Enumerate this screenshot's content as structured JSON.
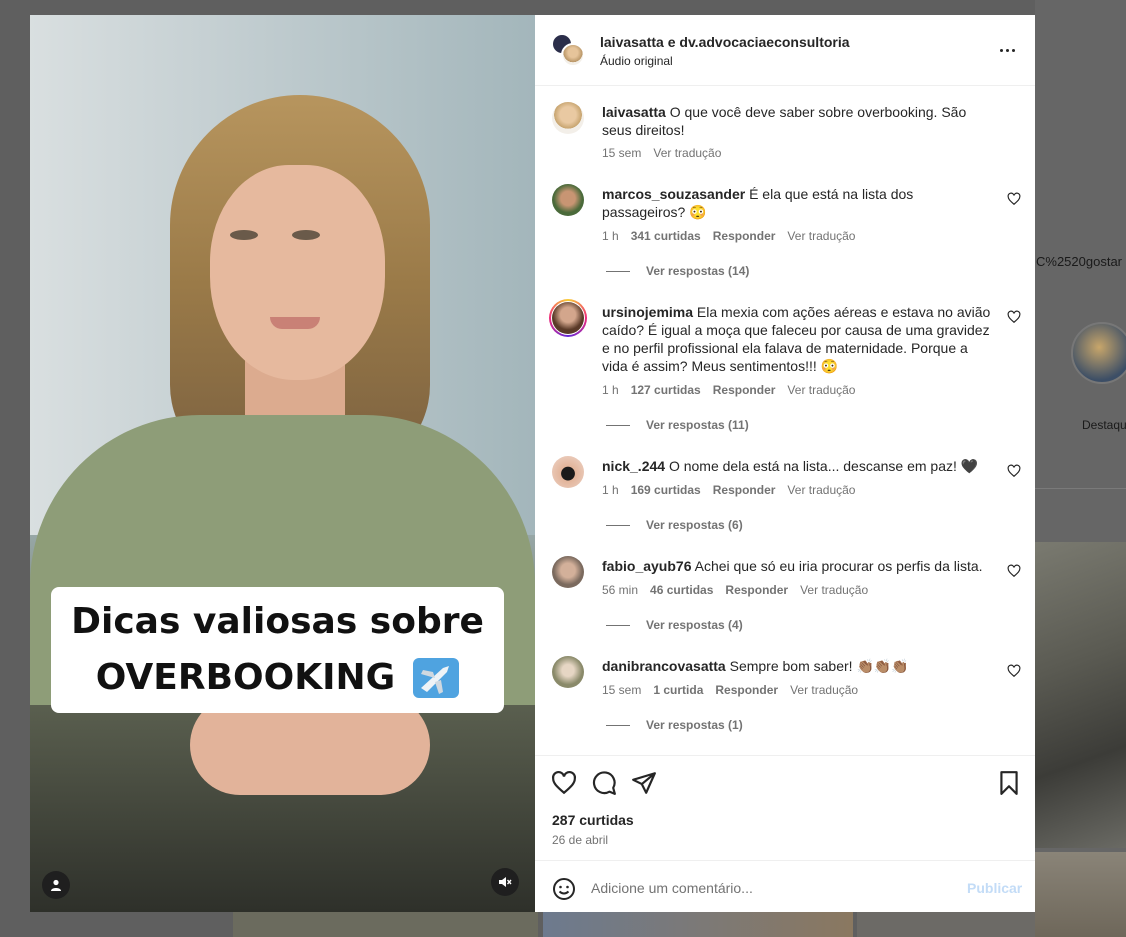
{
  "background": {
    "partial_text": "C%2520gostar",
    "highlight_label": "Destaqu"
  },
  "video": {
    "caption_line1": "Dicas valiosas sobre",
    "caption_line2": "OVERBOOKING",
    "caption_emoji": "airplane-icon"
  },
  "header": {
    "authors": "laivasatta e dv.advocaciaeconsultoria",
    "audio": "Áudio original",
    "more_icon": "more-options-icon"
  },
  "caption": {
    "user": "laivasatta",
    "text": "O que você deve saber sobre overbooking. São seus direitos!",
    "time": "15 sem",
    "translate": "Ver tradução"
  },
  "comments": [
    {
      "user": "marcos_souzasander",
      "text": "É ela que está na lista dos passageiros? 😳",
      "time": "1 h",
      "likes": "341 curtidas",
      "reply": "Responder",
      "translate": "Ver tradução",
      "replies": "Ver respostas (14)"
    },
    {
      "user": "ursinojemima",
      "text": "Ela mexia com ações aéreas e estava no avião caído? É igual a moça que faleceu por causa de uma gravidez e no perfil profissional ela falava de maternidade. Porque a vida é assim? Meus sentimentos!!! 😳",
      "time": "1 h",
      "likes": "127 curtidas",
      "reply": "Responder",
      "translate": "Ver tradução",
      "replies": "Ver respostas (11)"
    },
    {
      "user": "nick_.244",
      "text": "O nome dela está na lista... descanse em paz! 🖤",
      "time": "1 h",
      "likes": "169 curtidas",
      "reply": "Responder",
      "translate": "Ver tradução",
      "replies": "Ver respostas (6)"
    },
    {
      "user": "fabio_ayub76",
      "text": "Achei que só eu iria procurar os perfis da lista.",
      "time": "56 min",
      "likes": "46 curtidas",
      "reply": "Responder",
      "translate": "Ver tradução",
      "replies": "Ver respostas (4)"
    },
    {
      "user": "danibrancovasatta",
      "text": "Sempre bom saber! 👏🏽👏🏽👏🏽",
      "time": "15 sem",
      "likes": "1 curtida",
      "reply": "Responder",
      "translate": "Ver tradução",
      "replies": "Ver respostas (1)"
    }
  ],
  "footer": {
    "likes": "287 curtidas",
    "date": "26 de abril",
    "comment_placeholder": "Adicione um comentário...",
    "publish": "Publicar"
  },
  "colors": {
    "text_primary": "#262626",
    "text_secondary": "#737373",
    "publish_disabled": "#c3dcf7"
  }
}
